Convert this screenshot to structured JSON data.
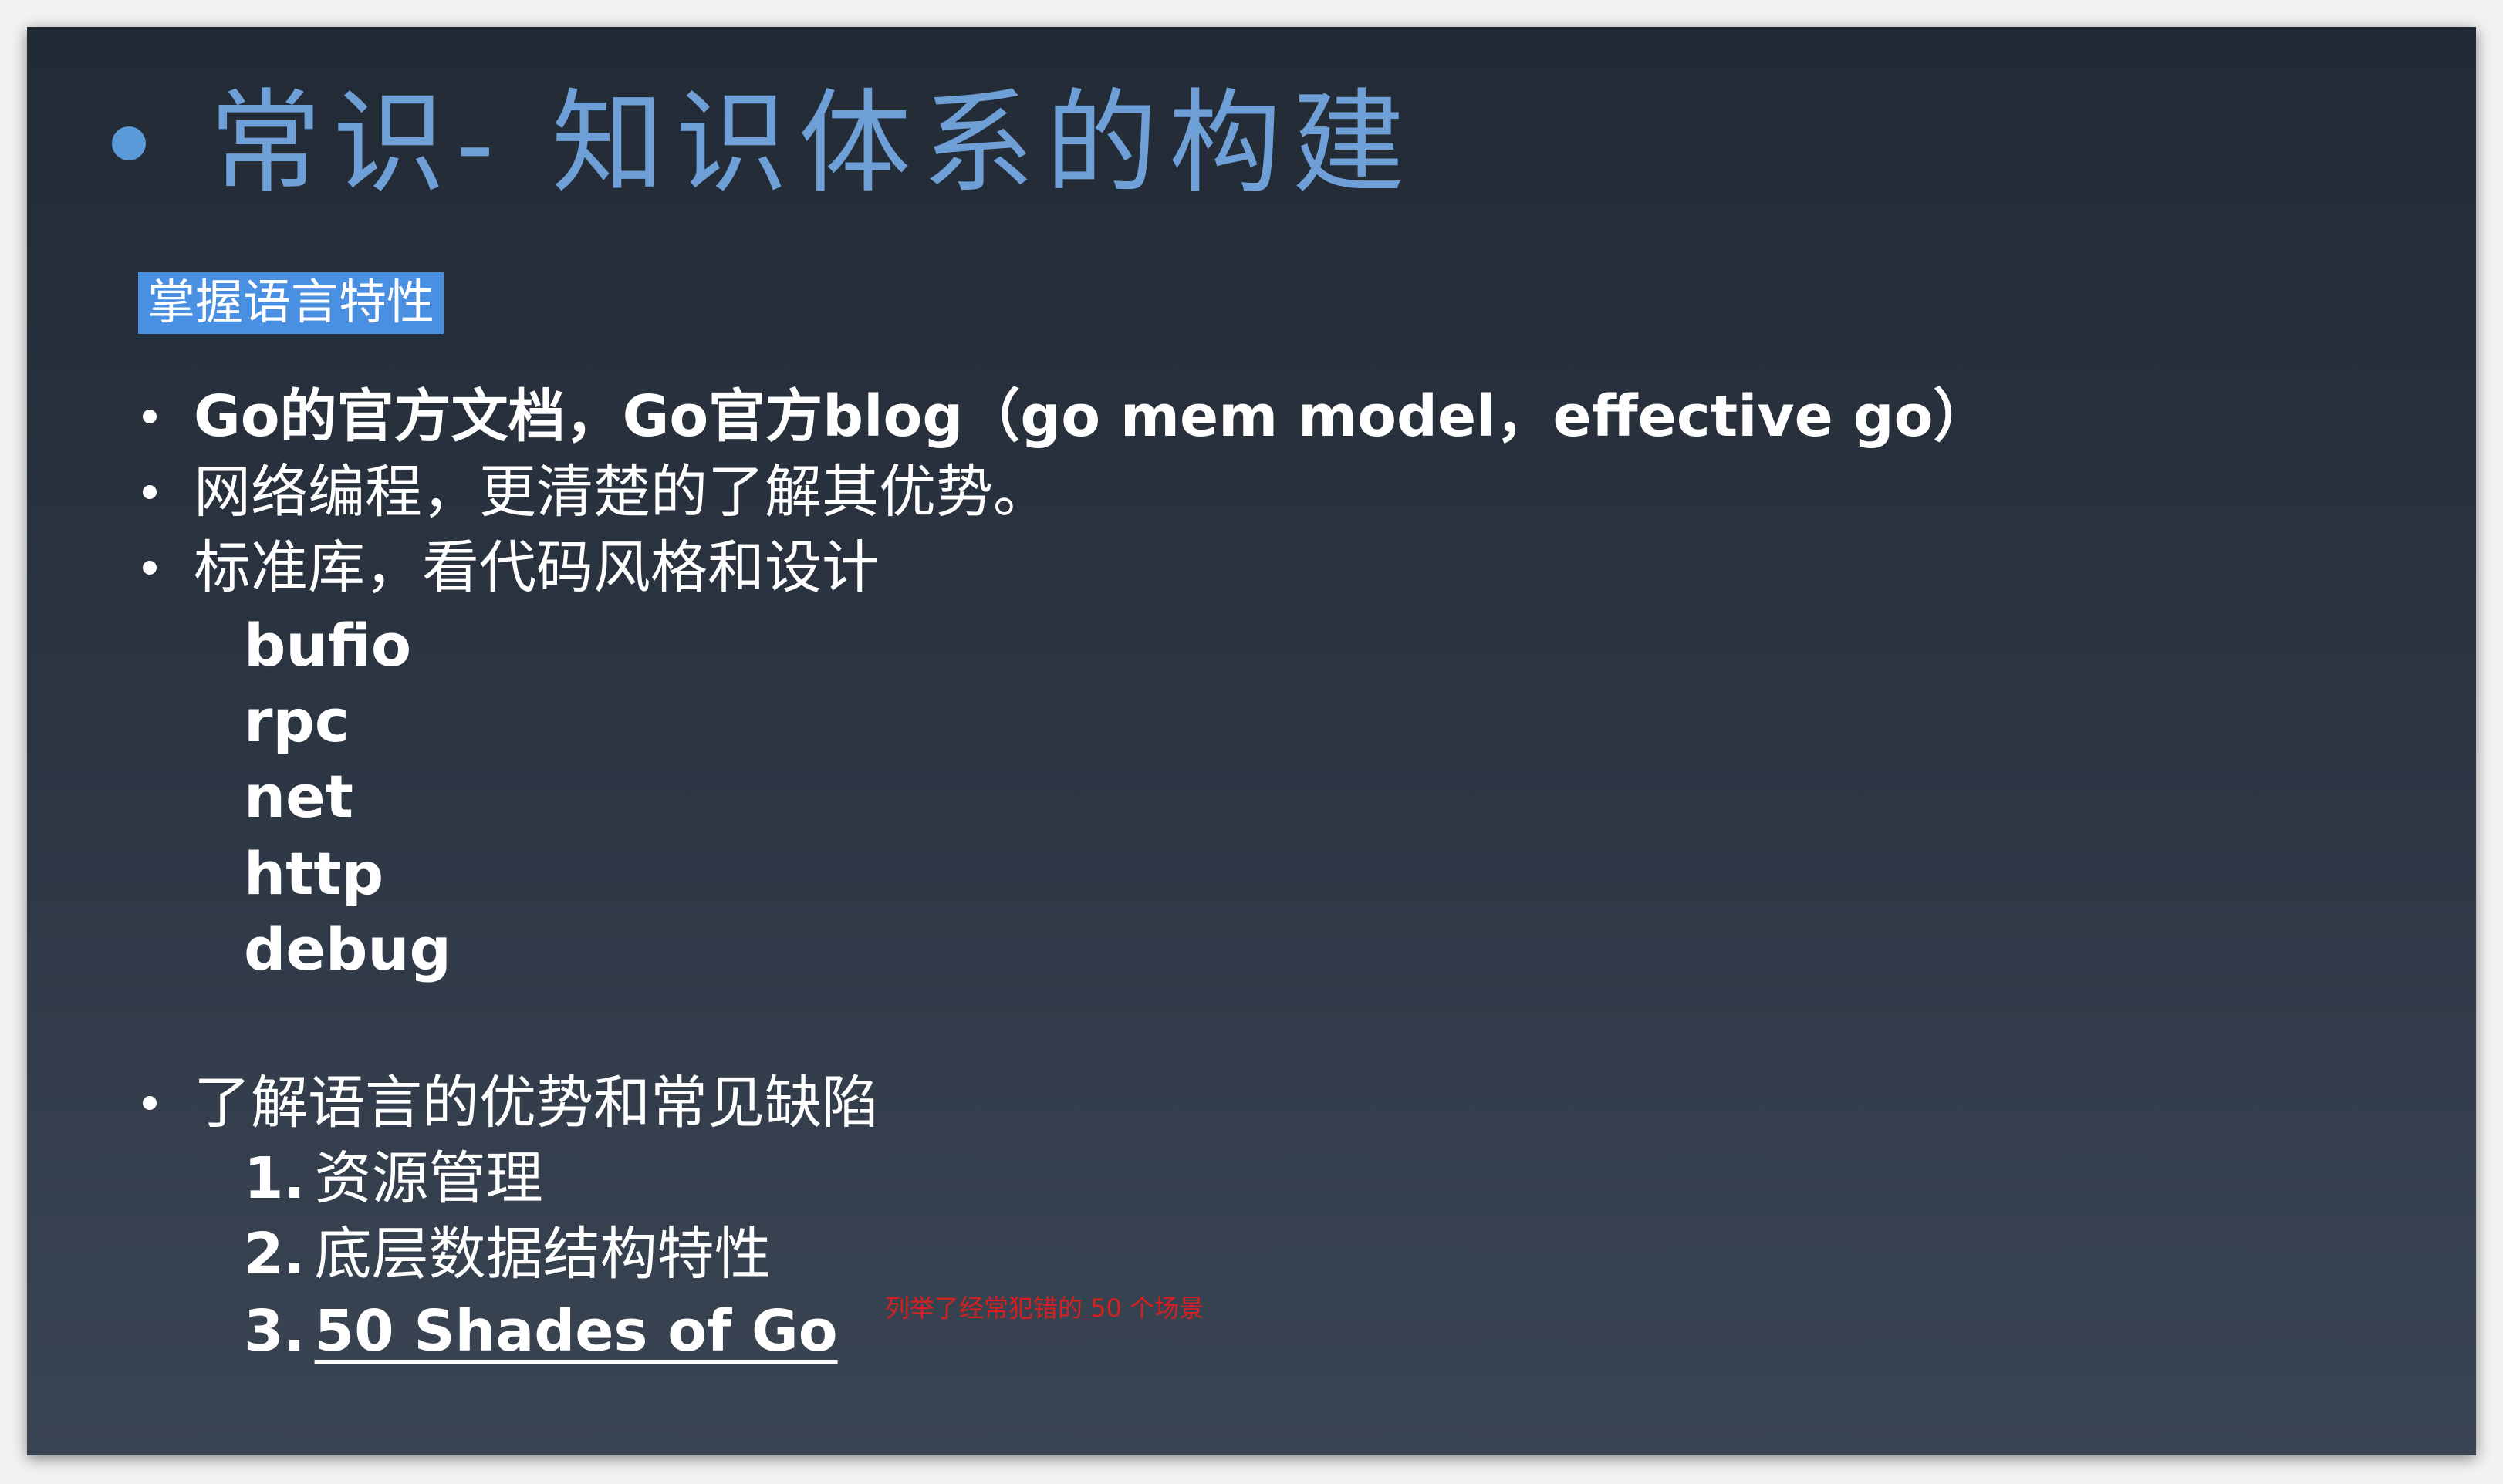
{
  "slide": {
    "title": "常识- 知识体系的构建",
    "highlight_label": "掌握语言特性",
    "bullets": [
      {
        "text": "Go的官方文档，Go官方blog（go mem model，effective go）"
      },
      {
        "text": "网络编程，更清楚的了解其优势。"
      },
      {
        "text": "标准库，看代码风格和设计"
      }
    ],
    "stdlib_packages": [
      "bufio",
      "rpc",
      "net",
      "http",
      "debug"
    ],
    "bullet4": {
      "text": "了解语言的优势和常见缺陷"
    },
    "numbered": [
      {
        "num": "1.",
        "text": "资源管理"
      },
      {
        "num": "2.",
        "text": "底层数据结构特性"
      },
      {
        "num": "3.",
        "text": "50 Shades of Go"
      }
    ],
    "annotation": "列举了经常犯错的 50 个场景"
  },
  "colors": {
    "title": "#6e9fd6",
    "title_bullet": "#5a9ad8",
    "highlight_bg": "#4a90e2",
    "annotation": "#d62020",
    "text": "#ffffff"
  }
}
